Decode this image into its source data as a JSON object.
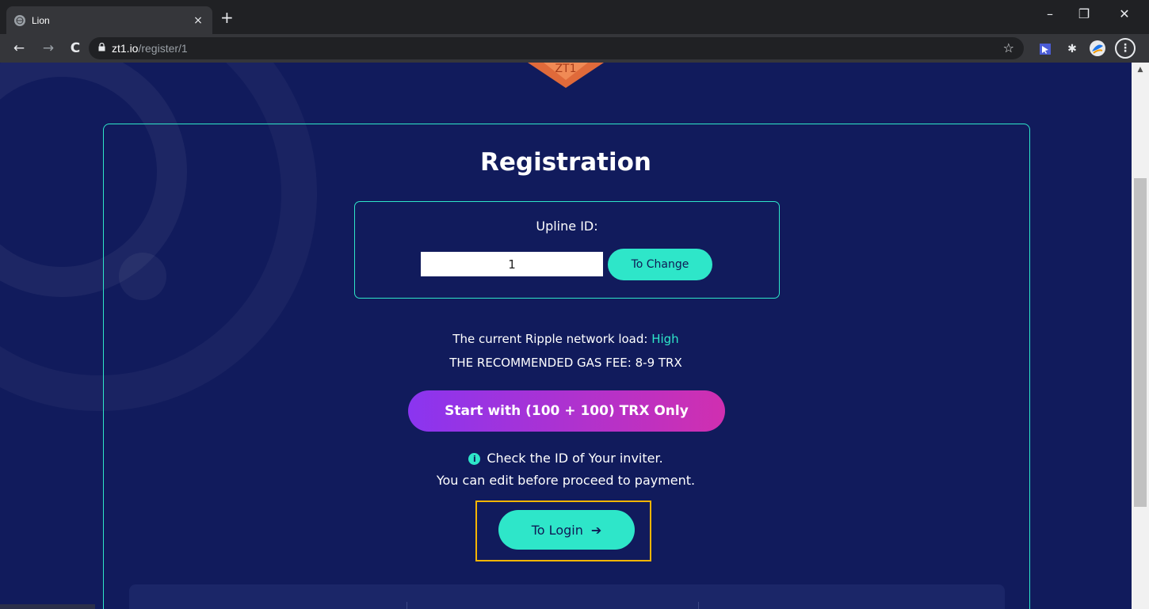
{
  "browser": {
    "tab_title": "Lion",
    "tab_close": "×",
    "new_tab": "+",
    "url_host": "zt1.io",
    "url_path": "/register/1",
    "window_controls": {
      "minimize": "–",
      "restore": "❐",
      "close": "✕"
    },
    "nav": {
      "back": "←",
      "forward": "→",
      "reload": "C"
    }
  },
  "logo": {
    "text": "ZT1",
    "color": "#e06a3a"
  },
  "registration": {
    "title": "Registration",
    "upline_label": "Upline ID:",
    "upline_value": "1",
    "change_button": "To Change",
    "network_load_label": "The current Ripple network load:",
    "network_load_value": "High",
    "gas_fee": "THE RECOMMENDED GAS FEE: 8-9 TRX",
    "start_button": "Start with (100 + 100) TRX Only",
    "info_text": "Check the ID of Your inviter.",
    "edit_text": "You can edit before proceed to payment.",
    "login_button": "To Login",
    "login_arrow": "➔"
  },
  "colors": {
    "background": "#111b5c",
    "accent": "#2ee6c9",
    "gradient_start": "#8a35f0",
    "gradient_end": "#d02fb0",
    "highlight": "#f7b500"
  },
  "icons": {
    "info": "i",
    "lock": "🔒",
    "star": "☆",
    "extensions": "✱",
    "menu": "⋮"
  }
}
